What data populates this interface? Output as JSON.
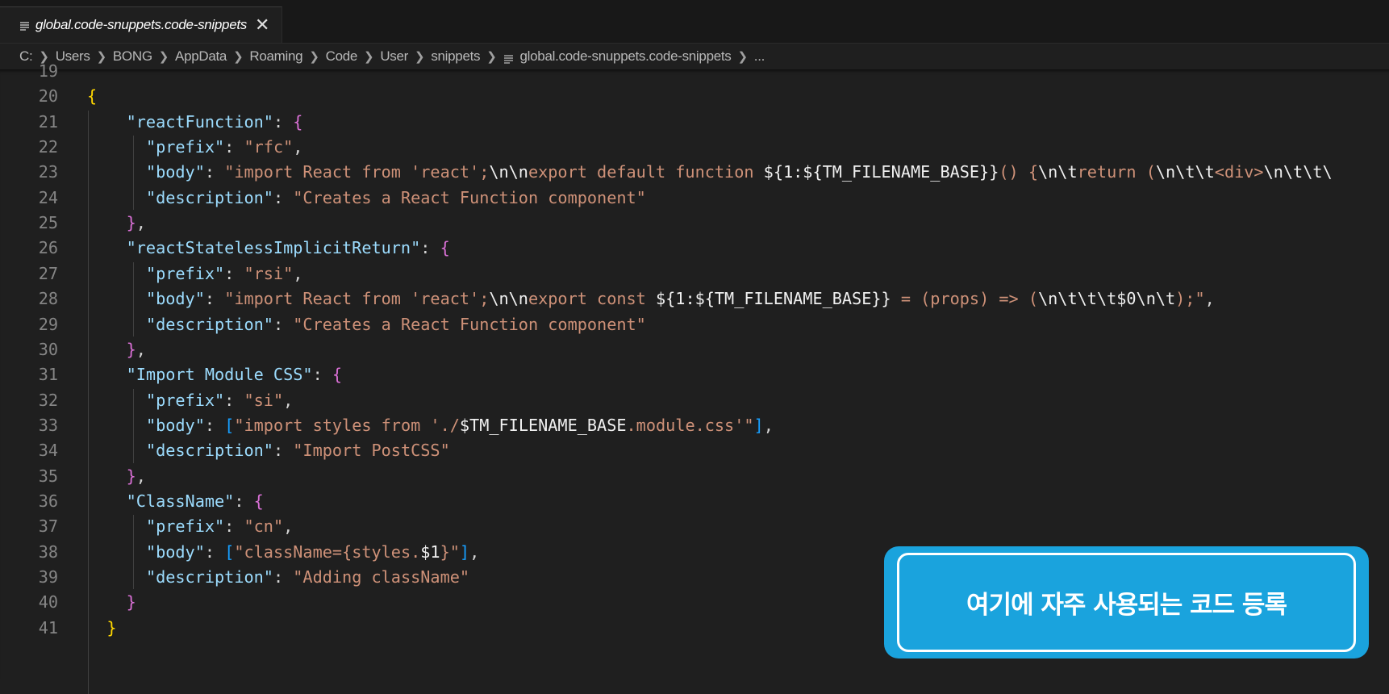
{
  "tab": {
    "icon": "lines-file-icon",
    "title": "global.code-snuppets.code-snippets",
    "close": "✕"
  },
  "breadcrumb": {
    "items": [
      "C:",
      "Users",
      "BONG",
      "AppData",
      "Roaming",
      "Code",
      "User",
      "snippets"
    ],
    "file": "global.code-snuppets.code-snippets",
    "more": "..."
  },
  "editor": {
    "lines": [
      {
        "n": "19",
        "tokens": []
      },
      {
        "n": "20",
        "tokens": [
          [
            "b1",
            "{"
          ]
        ]
      },
      {
        "n": "21",
        "tokens": [
          [
            "p",
            "    "
          ],
          [
            "k",
            "\"reactFunction\""
          ],
          [
            "p",
            ": "
          ],
          [
            "b2",
            "{"
          ]
        ]
      },
      {
        "n": "22",
        "tokens": [
          [
            "p",
            "      "
          ],
          [
            "k",
            "\"prefix\""
          ],
          [
            "p",
            ": "
          ],
          [
            "s",
            "\"rfc\""
          ],
          [
            "p",
            ","
          ]
        ]
      },
      {
        "n": "23",
        "tokens": [
          [
            "p",
            "      "
          ],
          [
            "k",
            "\"body\""
          ],
          [
            "p",
            ": "
          ],
          [
            "s",
            "\"import React from 'react';"
          ],
          [
            "w",
            "\\n\\n"
          ],
          [
            "s",
            "export default function "
          ],
          [
            "w",
            "${1:${TM_FILENAME_BASE}}"
          ],
          [
            "s",
            "() {"
          ],
          [
            "w",
            "\\n\\t"
          ],
          [
            "s",
            "return ("
          ],
          [
            "w",
            "\\n\\t\\t"
          ],
          [
            "s",
            "<div>"
          ],
          [
            "w",
            "\\n\\t\\t\\"
          ]
        ]
      },
      {
        "n": "24",
        "tokens": [
          [
            "p",
            "      "
          ],
          [
            "k",
            "\"description\""
          ],
          [
            "p",
            ": "
          ],
          [
            "s",
            "\"Creates a React Function component\""
          ]
        ]
      },
      {
        "n": "25",
        "tokens": [
          [
            "p",
            "    "
          ],
          [
            "b2",
            "}"
          ],
          [
            "p",
            ","
          ]
        ]
      },
      {
        "n": "26",
        "tokens": [
          [
            "p",
            "    "
          ],
          [
            "k",
            "\"reactStatelessImplicitReturn\""
          ],
          [
            "p",
            ": "
          ],
          [
            "b2",
            "{"
          ]
        ]
      },
      {
        "n": "27",
        "tokens": [
          [
            "p",
            "      "
          ],
          [
            "k",
            "\"prefix\""
          ],
          [
            "p",
            ": "
          ],
          [
            "s",
            "\"rsi\""
          ],
          [
            "p",
            ","
          ]
        ]
      },
      {
        "n": "28",
        "tokens": [
          [
            "p",
            "      "
          ],
          [
            "k",
            "\"body\""
          ],
          [
            "p",
            ": "
          ],
          [
            "s",
            "\"import React from 'react';"
          ],
          [
            "w",
            "\\n\\n"
          ],
          [
            "s",
            "export const "
          ],
          [
            "w",
            "${1:${TM_FILENAME_BASE}}"
          ],
          [
            "s",
            " = (props) => ("
          ],
          [
            "w",
            "\\n\\t\\t\\t$0\\n\\t"
          ],
          [
            "s",
            ");\""
          ],
          [
            "p",
            ","
          ]
        ]
      },
      {
        "n": "29",
        "tokens": [
          [
            "p",
            "      "
          ],
          [
            "k",
            "\"description\""
          ],
          [
            "p",
            ": "
          ],
          [
            "s",
            "\"Creates a React Function component\""
          ]
        ]
      },
      {
        "n": "30",
        "tokens": [
          [
            "p",
            "    "
          ],
          [
            "b2",
            "}"
          ],
          [
            "p",
            ","
          ]
        ]
      },
      {
        "n": "31",
        "tokens": [
          [
            "p",
            "    "
          ],
          [
            "k",
            "\"Import Module CSS\""
          ],
          [
            "p",
            ": "
          ],
          [
            "b2",
            "{"
          ]
        ]
      },
      {
        "n": "32",
        "tokens": [
          [
            "p",
            "      "
          ],
          [
            "k",
            "\"prefix\""
          ],
          [
            "p",
            ": "
          ],
          [
            "s",
            "\"si\""
          ],
          [
            "p",
            ","
          ]
        ]
      },
      {
        "n": "33",
        "tokens": [
          [
            "p",
            "      "
          ],
          [
            "k",
            "\"body\""
          ],
          [
            "p",
            ": "
          ],
          [
            "b3",
            "["
          ],
          [
            "s",
            "\"import styles from './"
          ],
          [
            "w",
            "$TM_FILENAME_BASE"
          ],
          [
            "s",
            ".module.css'\""
          ],
          [
            "b3",
            "]"
          ],
          [
            "p",
            ","
          ]
        ]
      },
      {
        "n": "34",
        "tokens": [
          [
            "p",
            "      "
          ],
          [
            "k",
            "\"description\""
          ],
          [
            "p",
            ": "
          ],
          [
            "s",
            "\"Import PostCSS\""
          ]
        ]
      },
      {
        "n": "35",
        "tokens": [
          [
            "p",
            "    "
          ],
          [
            "b2",
            "}"
          ],
          [
            "p",
            ","
          ]
        ]
      },
      {
        "n": "36",
        "tokens": [
          [
            "p",
            "    "
          ],
          [
            "k",
            "\"ClassName\""
          ],
          [
            "p",
            ": "
          ],
          [
            "b2",
            "{"
          ]
        ]
      },
      {
        "n": "37",
        "tokens": [
          [
            "p",
            "      "
          ],
          [
            "k",
            "\"prefix\""
          ],
          [
            "p",
            ": "
          ],
          [
            "s",
            "\"cn\""
          ],
          [
            "p",
            ","
          ]
        ]
      },
      {
        "n": "38",
        "tokens": [
          [
            "p",
            "      "
          ],
          [
            "k",
            "\"body\""
          ],
          [
            "p",
            ": "
          ],
          [
            "b3",
            "["
          ],
          [
            "s",
            "\"className={styles."
          ],
          [
            "w",
            "$1"
          ],
          [
            "s",
            "}\""
          ],
          [
            "b3",
            "]"
          ],
          [
            "p",
            ","
          ]
        ]
      },
      {
        "n": "39",
        "tokens": [
          [
            "p",
            "      "
          ],
          [
            "k",
            "\"description\""
          ],
          [
            "p",
            ": "
          ],
          [
            "s",
            "\"Adding className\""
          ]
        ]
      },
      {
        "n": "40",
        "tokens": [
          [
            "p",
            "    "
          ],
          [
            "b2",
            "}"
          ]
        ]
      },
      {
        "n": "41",
        "tokens": [
          [
            "p",
            "  "
          ],
          [
            "b1",
            "}"
          ]
        ]
      }
    ]
  },
  "callout": {
    "text": "여기에 자주 사용되는 코드 등록",
    "color": "#1aa3dd"
  },
  "colors": {
    "background": "#1f1f1f",
    "key": "#9cdcfe",
    "string": "#ce9178",
    "bracket_level1": "#ffd700",
    "bracket_level2": "#da70d6",
    "bracket_level3": "#179fff"
  }
}
